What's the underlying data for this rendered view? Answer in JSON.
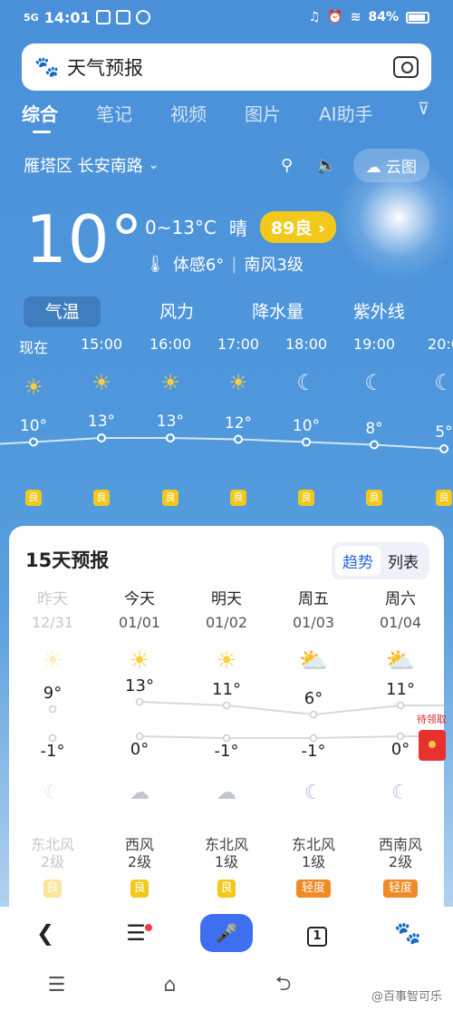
{
  "status": {
    "network": "5G",
    "time": "14:01",
    "battery": "84%"
  },
  "search": {
    "query": "天气预报"
  },
  "tabs": [
    "综合",
    "笔记",
    "视频",
    "图片",
    "AI助手"
  ],
  "location": {
    "name": "雁塔区 长安南路",
    "cloud_map": "云图"
  },
  "current": {
    "temp": "10°",
    "range": "0~13°C",
    "condition": "晴",
    "aqi": "89良 ›",
    "feel": "体感6°",
    "wind": "南风3级"
  },
  "seg_tabs": [
    "气温",
    "风力",
    "降水量",
    "紫外线"
  ],
  "hourly": [
    {
      "time": "现在",
      "icon": "sun-icon",
      "temp": 10,
      "temp_label": "10°",
      "aq": "良"
    },
    {
      "time": "15:00",
      "icon": "sun-icon",
      "temp": 13,
      "temp_label": "13°",
      "aq": "良"
    },
    {
      "time": "16:00",
      "icon": "sun-icon",
      "temp": 13,
      "temp_label": "13°",
      "aq": "良"
    },
    {
      "time": "17:00",
      "icon": "sun-icon",
      "temp": 12,
      "temp_label": "12°",
      "aq": "良"
    },
    {
      "time": "18:00",
      "icon": "moon-icon",
      "temp": 10,
      "temp_label": "10°",
      "aq": "良"
    },
    {
      "time": "19:00",
      "icon": "moon-icon",
      "temp": 8,
      "temp_label": "8°",
      "aq": "良"
    },
    {
      "time": "20:0",
      "icon": "moon-icon",
      "temp": 5,
      "temp_label": "5°",
      "aq": "良"
    }
  ],
  "forecast": {
    "title": "15天预报",
    "toggle": [
      "趋势",
      "列表"
    ],
    "days": [
      {
        "name": "昨天",
        "date": "12/31",
        "icon": "sun-icon",
        "hi": 9,
        "hi_label": "9°",
        "lo": -1,
        "lo_label": "-1°",
        "night_icon": "moon-icon",
        "wind1": "东北风",
        "wind2": "2级",
        "aq": "良",
        "aq_level": "good",
        "past": true
      },
      {
        "name": "今天",
        "date": "01/01",
        "icon": "sun-icon",
        "hi": 13,
        "hi_label": "13°",
        "lo": 0,
        "lo_label": "0°",
        "night_icon": "cloud-icon",
        "wind1": "西风",
        "wind2": "2级",
        "aq": "良",
        "aq_level": "good",
        "past": false
      },
      {
        "name": "明天",
        "date": "01/02",
        "icon": "sun-icon",
        "hi": 11,
        "hi_label": "11°",
        "lo": -1,
        "lo_label": "-1°",
        "night_icon": "cloud-icon",
        "wind1": "东北风",
        "wind2": "1级",
        "aq": "良",
        "aq_level": "good",
        "past": false
      },
      {
        "name": "周五",
        "date": "01/03",
        "icon": "partly-cloudy-icon",
        "hi": 6,
        "hi_label": "6°",
        "lo": -1,
        "lo_label": "-1°",
        "night_icon": "moon-cloud-icon",
        "wind1": "东北风",
        "wind2": "1级",
        "aq": "轻度",
        "aq_level": "light",
        "past": false
      },
      {
        "name": "周六",
        "date": "01/04",
        "icon": "partly-cloudy-icon",
        "hi": 11,
        "hi_label": "11°",
        "lo": 0,
        "lo_label": "0°",
        "night_icon": "moon-icon",
        "wind1": "西南风",
        "wind2": "2级",
        "aq": "轻度",
        "aq_level": "light",
        "past": false
      }
    ]
  },
  "redpacket": {
    "label": "待领取"
  },
  "bottom_nav": {
    "tabs_count": "1"
  },
  "watermark": "@百事智可乐",
  "colors": {
    "accent": "#3d6ff0",
    "good": "#f2c91a",
    "light_pollution": "#f08a24",
    "sky": "#4a90d9"
  }
}
